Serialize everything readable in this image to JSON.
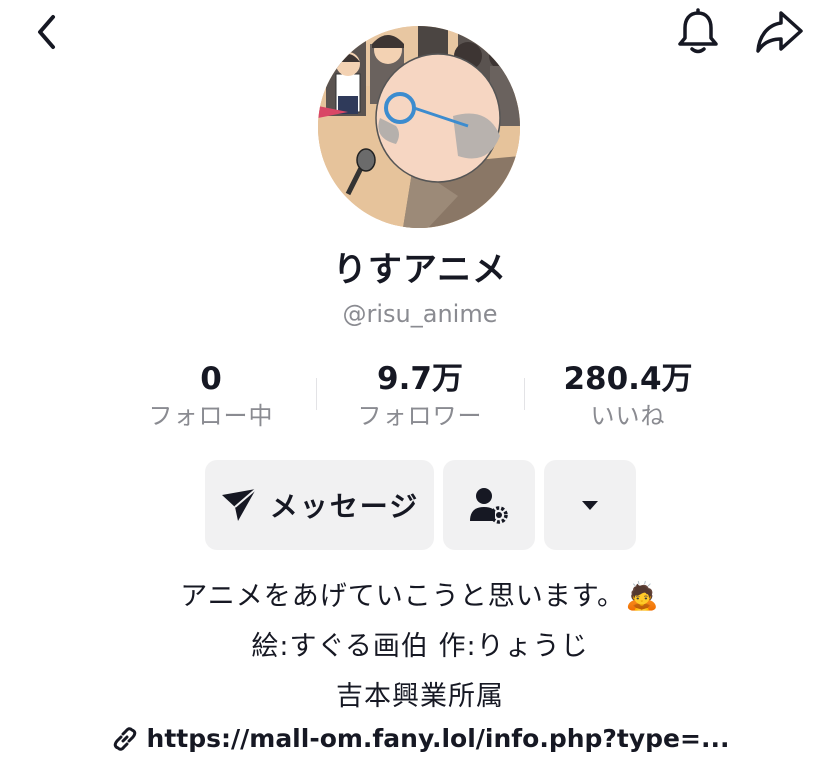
{
  "profile": {
    "display_name": "りすアニメ",
    "username": "@risu_anime"
  },
  "stats": {
    "following_count": "0",
    "following_label": "フォロー中",
    "followers_count": "9.7万",
    "followers_label": "フォロワー",
    "likes_count": "280.4万",
    "likes_label": "いいね"
  },
  "actions": {
    "message_label": "メッセージ"
  },
  "bio": {
    "line1": "アニメをあげていこうと思います。🙇",
    "line2": "絵:すぐる画伯 作:りょうじ",
    "line3": "吉本興業所属"
  },
  "link": {
    "text": "https://mall-om.fany.lol/info.php?type=..."
  },
  "icons": {
    "back": "chevron-left-icon",
    "notifications": "bell-icon",
    "share": "share-arrow-icon",
    "message": "send-icon",
    "friend_settings": "user-gear-icon",
    "more": "caret-down-icon",
    "link": "link-icon"
  }
}
